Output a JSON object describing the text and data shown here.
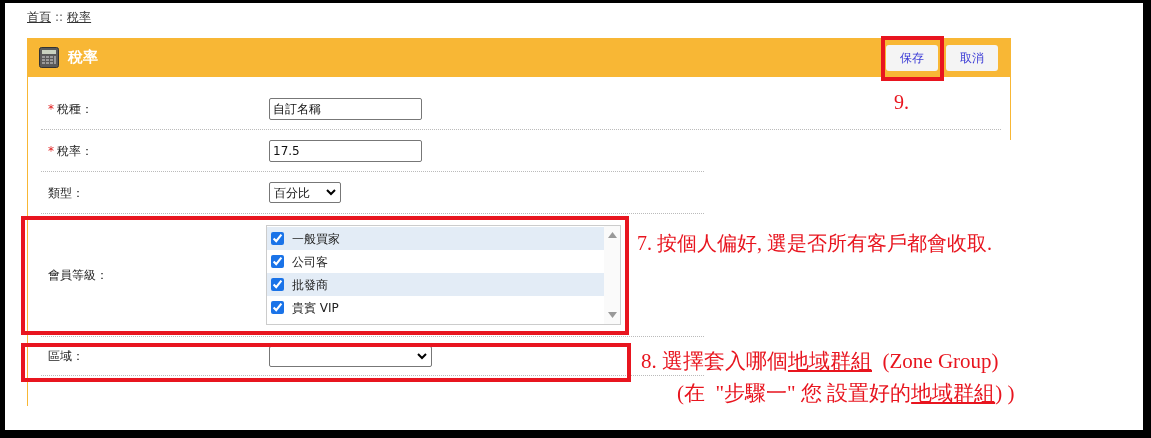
{
  "breadcrumb": [
    {
      "label": "首頁"
    },
    {
      "label": "稅率"
    }
  ],
  "breadcrumb_separator": "::",
  "panel": {
    "title": "稅率",
    "buttons": [
      {
        "label": "保存"
      },
      {
        "label": "取消"
      }
    ]
  },
  "form_rows": [
    {
      "kind": "text",
      "label": "稅種：",
      "required_mark": "*",
      "value": "自訂名稱"
    },
    {
      "kind": "text",
      "label": "稅率：",
      "required_mark": "*",
      "value": "17.5"
    },
    {
      "kind": "select",
      "label": "類型：",
      "value": "百分比"
    },
    {
      "kind": "checklist",
      "label": "會員等級：",
      "options": [
        {
          "label": "一般買家",
          "checked": true
        },
        {
          "label": "公司客",
          "checked": true
        },
        {
          "label": "批發商",
          "checked": true
        },
        {
          "label": "貴賓 VIP",
          "checked": true
        }
      ]
    },
    {
      "kind": "wideselect",
      "label": "區域："
    }
  ],
  "annotations": [
    {
      "lines": [
        [
          {
            "text": "9."
          }
        ]
      ]
    },
    {
      "lines": [
        [
          {
            "text": "7. 按個人偏好, 選是否所有客戶都會收取."
          }
        ]
      ]
    },
    {
      "lines": [
        [
          {
            "text": "8. 選擇套入哪個"
          },
          {
            "text": "地域群組",
            "underline": true
          },
          {
            "text": "  (Zone Group)"
          }
        ],
        [
          {
            "text": "(在  \"步驟一\" 您 設置好的"
          },
          {
            "text": "地域群組",
            "underline": true
          },
          {
            "text": ") )"
          }
        ]
      ]
    }
  ]
}
